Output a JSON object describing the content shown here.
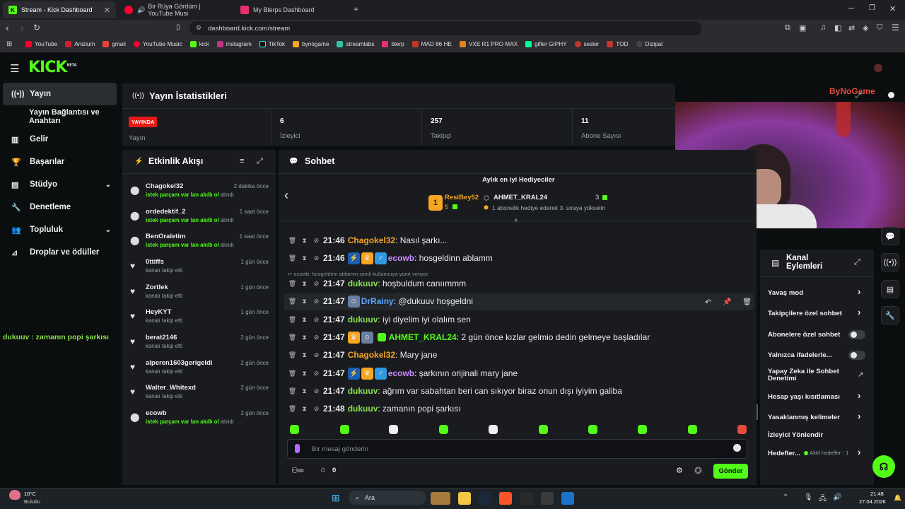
{
  "browser": {
    "tabs": [
      {
        "label": "Stream - Kick Dashboard",
        "close": "✕"
      },
      {
        "label": "Bir Rüya Gördüm | YouTube Musi"
      },
      {
        "label": "My Blerps Dashboard"
      }
    ],
    "new_tab": "+",
    "url": "dashboard.kick.com/stream",
    "bookmarks": [
      "YouTube",
      "Anizium",
      "gmail",
      "YouTube Music",
      "kick",
      "instagram",
      "TikTok",
      "bynogame",
      "streamlabs",
      "blerp",
      "MAD 86 HE",
      "VXE R1 PRO MAX",
      "gifler GIPHY",
      "sesler",
      "TOD",
      "Dizipal"
    ]
  },
  "app": {
    "logo": "KICK",
    "logo_sup": "BETA",
    "sidebar": [
      {
        "label": "Yayın",
        "icon": "broadcast-icon"
      },
      {
        "label": "Yayın Bağlantısı ve Anahtarı",
        "icon": ""
      },
      {
        "label": "Gelir",
        "icon": "chart-icon"
      },
      {
        "label": "Başarılar",
        "icon": "trophy-icon"
      },
      {
        "label": "Stüdyo",
        "icon": "studio-icon"
      },
      {
        "label": "Denetleme",
        "icon": "wrench-icon"
      },
      {
        "label": "Topluluk",
        "icon": "community-icon"
      },
      {
        "label": "Droplar ve ödüller",
        "icon": "drops-icon"
      }
    ],
    "stats": {
      "title": "Yayın İstatistikleri",
      "live_badge": "YAYINDA",
      "live_label": "Yayın",
      "viewers": "6",
      "viewers_label": "İzleyici",
      "followers": "257",
      "followers_label": "Takipçi",
      "subs": "11",
      "subs_label": "Abone Sayısı"
    },
    "overlay_text": "dukuuv : zamanın popi şarkısı",
    "watermark": "ByNoGame"
  },
  "activity": {
    "title": "Etkinlik Akışı",
    "items": [
      {
        "name": "Chagokel32",
        "time": "2 dakika önce",
        "sub": "istek parçam var lan akıllı ol",
        "suffix": "alındı",
        "icon": "redeem-icon"
      },
      {
        "name": "ordedektif_2",
        "time": "1 saat önce",
        "sub": "istek parçam var lan akıllı ol",
        "suffix": "alındı",
        "icon": "redeem-icon"
      },
      {
        "name": "BenOraletim",
        "time": "1 saat önce",
        "sub": "istek parçam var lan akıllı ol",
        "suffix": "alındı",
        "icon": "redeem-icon"
      },
      {
        "name": "0ttiffs",
        "time": "1 gün önce",
        "sub": "kanalı takip etti",
        "suffix": "",
        "icon": "heart-icon"
      },
      {
        "name": "Zortlek",
        "time": "1 gün önce",
        "sub": "kanalı takip etti",
        "suffix": "",
        "icon": "heart-icon"
      },
      {
        "name": "HeyKYT",
        "time": "1 gün önce",
        "sub": "kanalı takip etti",
        "suffix": "",
        "icon": "heart-icon"
      },
      {
        "name": "berat2146",
        "time": "2 gün önce",
        "sub": "kanalı takip etti",
        "suffix": "",
        "icon": "heart-icon"
      },
      {
        "name": "alperen1603gerigeldi",
        "time": "2 gün önce",
        "sub": "kanalı takip etti",
        "suffix": "",
        "icon": "heart-icon"
      },
      {
        "name": "Walter_Whitexd",
        "time": "2 gün önce",
        "sub": "kanalı takip etti",
        "suffix": "",
        "icon": "heart-icon"
      },
      {
        "name": "ecowb",
        "time": "2 gün önce",
        "sub": "istek parçam var lan akıllı ol",
        "suffix": "alındı",
        "icon": "redeem-icon"
      }
    ]
  },
  "chat": {
    "title": "Sohbet",
    "gifters": {
      "title": "Aylık en iyi Hediyeciler",
      "rank_badge": "1",
      "first_name": "ResiBey52",
      "first_count": "5",
      "second_name": "AHMET_KRAL24",
      "second_count": "3",
      "second_sub": "1 abonelik hediye ederek 3. sıraya yükselin"
    },
    "reply_hint": "ecowb: hosgeldinn ablamm isimli kullanıcıya yanıt veriyor",
    "messages": [
      {
        "time": "21:46",
        "user": "Chagokel32",
        "color": "#f5a623",
        "text": "Nasıl şarkı..."
      },
      {
        "time": "21:46",
        "user": "ecowb",
        "color": "#c98bff",
        "text": "hosgeldinn ablamm"
      },
      {
        "time": "21:47",
        "user": "dukuuv",
        "color": "#8be04e",
        "text": "hoşbuldum canıımmm"
      },
      {
        "time": "21:47",
        "user": "DrRainy",
        "color": "#5aa7ff",
        "text": "@dukuuv hoşgeldni"
      },
      {
        "time": "21:47",
        "user": "dukuuv",
        "color": "#8be04e",
        "text": "iyi diyelim iyi olalım sen"
      },
      {
        "time": "21:47",
        "user": "AHMET_KRAL24",
        "color": "#53fc18",
        "text": "2 gün önce kızlar gelmio dedin gelmeye başladılar"
      },
      {
        "time": "21:47",
        "user": "Chagokel32",
        "color": "#f5a623",
        "text": "Mary jane"
      },
      {
        "time": "21:47",
        "user": "ecowb",
        "color": "#c98bff",
        "text": "şarkının orijinali mary jane"
      },
      {
        "time": "21:47",
        "user": "dukuuv",
        "color": "#8be04e",
        "text": "ağrım var sabahtan beri can sıkıyor biraz onun dışı iyiyim galiba"
      },
      {
        "time": "21:48",
        "user": "dukuuv",
        "color": "#8be04e",
        "text": "zamanın popi şarkısı"
      }
    ],
    "input_placeholder": "Bir mesaj gönderin",
    "points": "0",
    "send_label": "Gönder"
  },
  "channel_actions": {
    "title_line1": "Kanal",
    "title_line2": "Eylemleri",
    "items": [
      {
        "label": "Yavaş mod",
        "control": "chevron"
      },
      {
        "label": "Takipçilere özel sohbet",
        "control": "chevron"
      },
      {
        "label": "Abonelere özel sohbet",
        "control": "toggle"
      },
      {
        "label": "Yalnızca ifadelerle...",
        "control": "toggle"
      },
      {
        "label": "Yapay Zeka ile Sohbet Denetimi",
        "control": "external"
      },
      {
        "label": "Hesap yaşı kısıtlaması",
        "control": "chevron"
      },
      {
        "label": "Yasaklanmış kelimeler",
        "control": "chevron"
      },
      {
        "label": "İzleyici Yönlendir",
        "control": "none"
      },
      {
        "label": "Hedefler...",
        "control": "chevron",
        "extra": "Aktif hedefler - 1"
      }
    ]
  },
  "taskbar": {
    "weather_temp": "10°C",
    "weather_desc": "Bulutlu",
    "search": "Ara",
    "time": "21:48",
    "date": "27.04.2026"
  },
  "colors": {
    "accent": "#53fc18",
    "panel": "#191b1f",
    "bg": "#0b0e0f",
    "live": "#e91916"
  }
}
